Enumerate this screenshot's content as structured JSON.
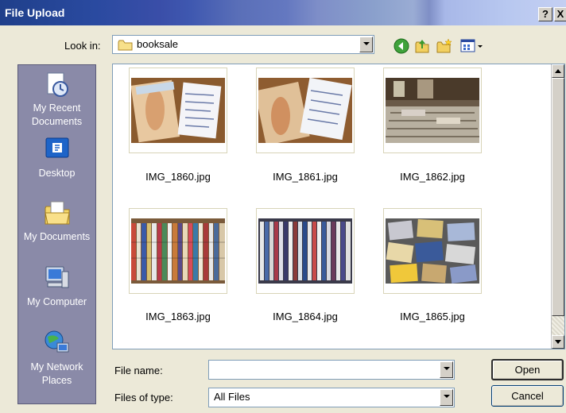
{
  "window": {
    "title": "File Upload",
    "help_label": "?",
    "close_label": "X"
  },
  "lookin": {
    "label": "Look in:",
    "value": "booksale"
  },
  "toolbar": {
    "icons": [
      "back-icon",
      "up-folder-icon",
      "new-folder-icon",
      "views-menu-icon"
    ]
  },
  "places": [
    {
      "label": "My Recent Documents",
      "icon": "recent-documents-icon"
    },
    {
      "label": "Desktop",
      "icon": "desktop-icon"
    },
    {
      "label": "My Documents",
      "icon": "my-documents-icon"
    },
    {
      "label": "My Computer",
      "icon": "my-computer-icon"
    },
    {
      "label": "My Network Places",
      "icon": "network-places-icon"
    }
  ],
  "files": [
    {
      "name": "IMG_1860.jpg"
    },
    {
      "name": "IMG_1861.jpg"
    },
    {
      "name": "IMG_1862.jpg"
    },
    {
      "name": "IMG_1863.jpg"
    },
    {
      "name": "IMG_1864.jpg"
    },
    {
      "name": "IMG_1865.jpg"
    }
  ],
  "form": {
    "file_name_label": "File name:",
    "file_name_value": "",
    "file_type_label": "Files of type:",
    "file_type_value": "All Files",
    "open_label": "Open",
    "cancel_label": "Cancel"
  }
}
